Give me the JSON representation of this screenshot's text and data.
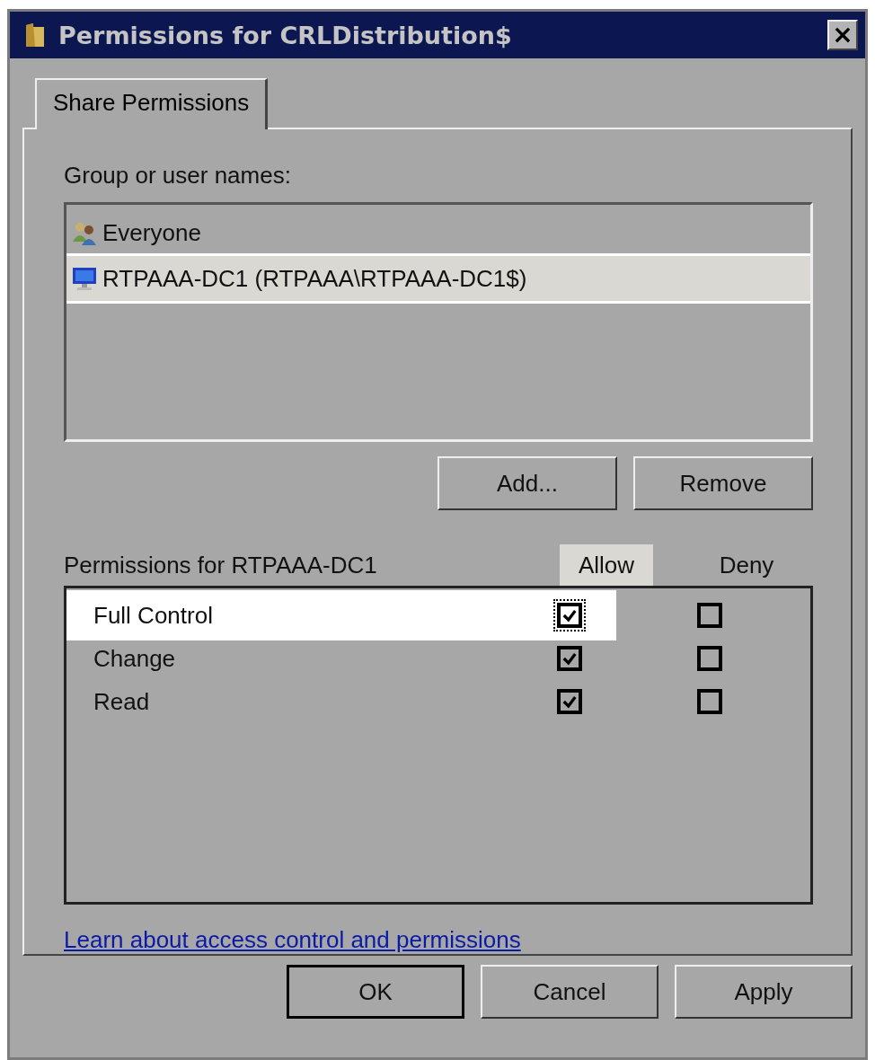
{
  "window": {
    "title": "Permissions for CRLDistribution$",
    "close": "×"
  },
  "tabs": [
    {
      "label": "Share Permissions",
      "selected": true
    }
  ],
  "users": {
    "label": "Group or user names:",
    "items": [
      {
        "name": "Everyone",
        "kind": "group",
        "selected": false
      },
      {
        "name": "RTPAAA-DC1 (RTPAAA\\RTPAAA-DC1$)",
        "kind": "computer",
        "selected": true
      }
    ]
  },
  "user_buttons": [
    "Add...",
    "Remove"
  ],
  "permissions": {
    "label": "Permissions for RTPAAA-DC1",
    "columns": [
      {
        "label": "Allow",
        "selected": true
      },
      {
        "label": "Deny",
        "selected": false
      }
    ],
    "rows": [
      {
        "name": "Full Control",
        "selected": true,
        "allow": true,
        "deny": false
      },
      {
        "name": "Change",
        "selected": false,
        "allow": true,
        "deny": false
      },
      {
        "name": "Read",
        "selected": false,
        "allow": true,
        "deny": false
      }
    ]
  },
  "link": "Learn about access control and permissions",
  "buttons": [
    {
      "label": "OK",
      "default": true
    },
    {
      "label": "Cancel",
      "default": false
    },
    {
      "label": "Apply",
      "default": false
    }
  ]
}
